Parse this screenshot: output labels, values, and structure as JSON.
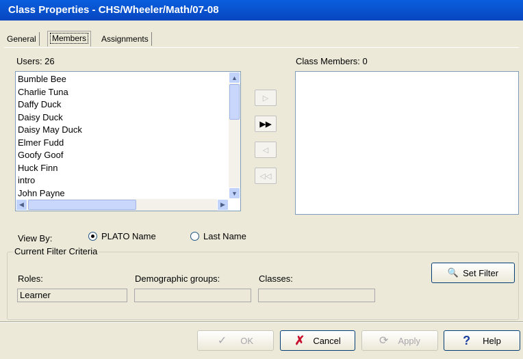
{
  "window": {
    "title": "Class Properties - CHS/Wheeler/Math/07-08"
  },
  "tabs": [
    {
      "label": "General"
    },
    {
      "label": "Members"
    },
    {
      "label": "Assignments"
    }
  ],
  "users": {
    "label": "Users: 26",
    "items": [
      "Bumble Bee",
      "Charlie Tuna",
      "Daffy Duck",
      "Daisy Duck",
      "Daisy May Duck",
      "Elmer Fudd",
      "Goofy Goof",
      "Huck Finn",
      "intro",
      "John Payne"
    ]
  },
  "class_members": {
    "label": "Class Members: 0"
  },
  "view_by": {
    "label": "View By:",
    "options": [
      {
        "label": "PLATO Name",
        "selected": true
      },
      {
        "label": "Last Name",
        "selected": false
      }
    ]
  },
  "filter": {
    "title": "Current Filter Criteria",
    "roles_label": "Roles:",
    "roles_value": "Learner",
    "demographic_label": "Demographic groups:",
    "demographic_value": "",
    "classes_label": "Classes:",
    "classes_value": "",
    "set_filter_label": "Set Filter"
  },
  "buttons": {
    "ok": "OK",
    "cancel": "Cancel",
    "apply": "Apply",
    "help": "Help"
  }
}
